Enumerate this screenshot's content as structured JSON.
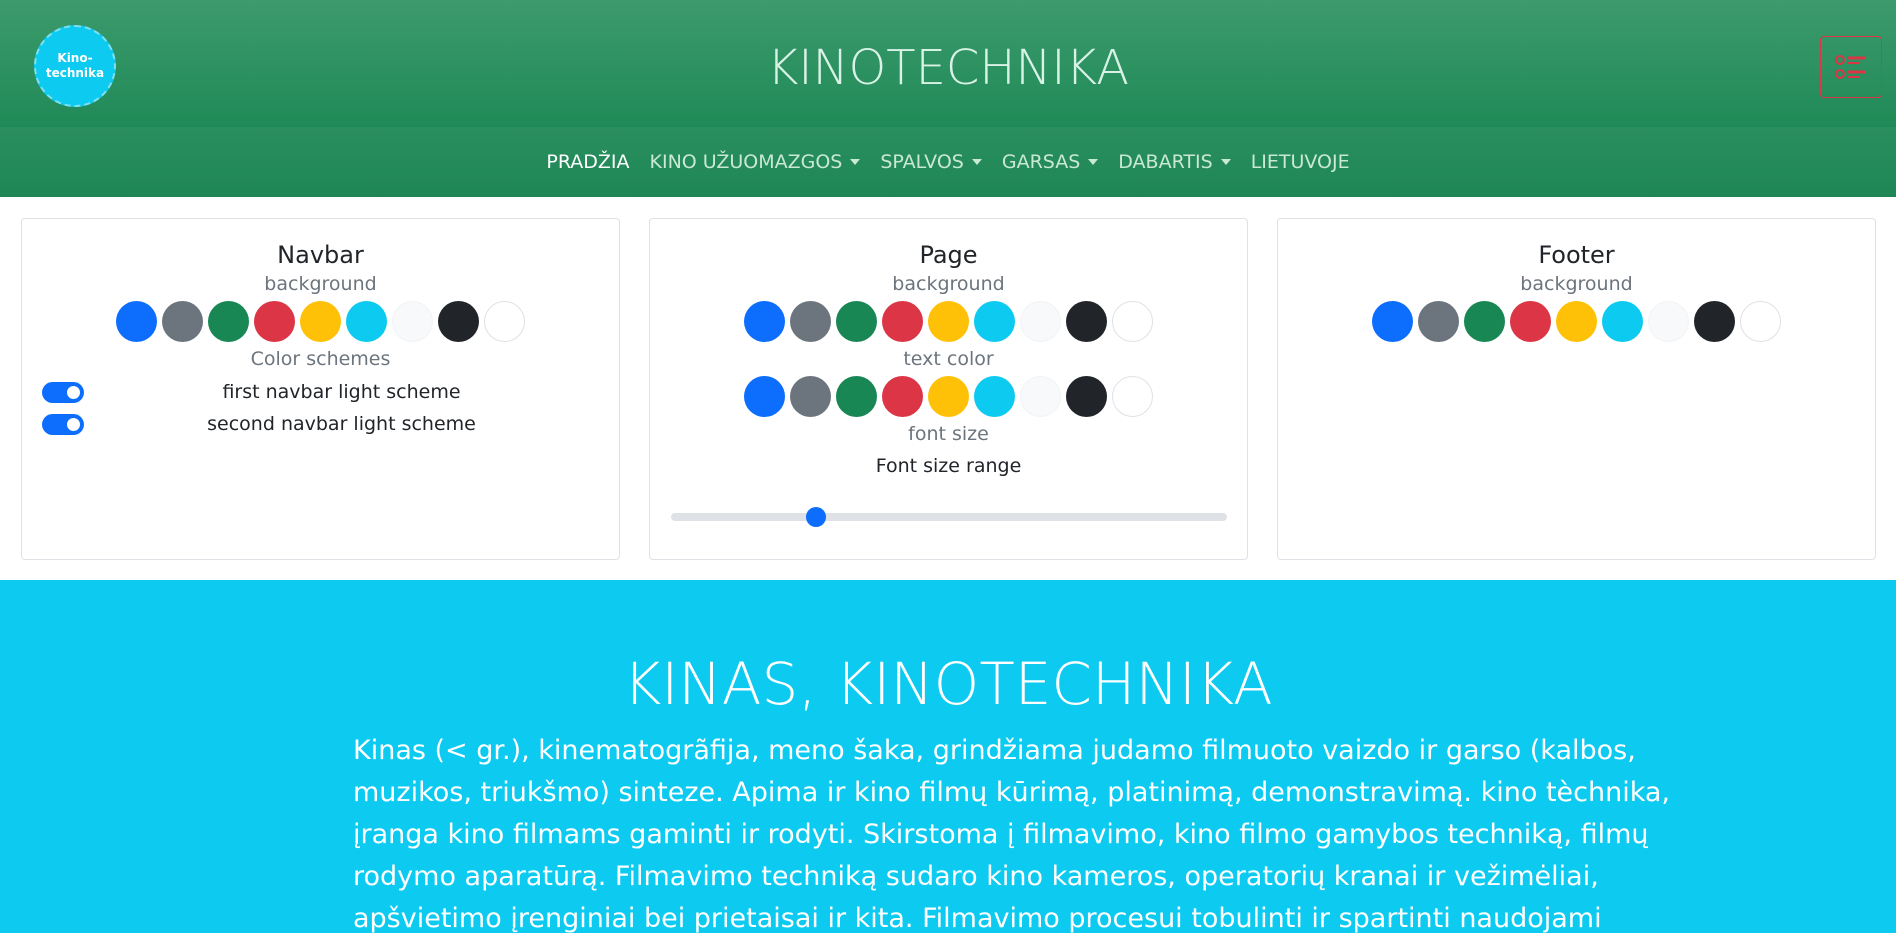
{
  "header": {
    "logo_text": "Kino-\ntechnika",
    "title": "KINOTECHNIKA",
    "settings_icon": "settings-list-icon"
  },
  "nav": {
    "items": [
      {
        "label": "PRADŽIA",
        "dropdown": false,
        "active": true
      },
      {
        "label": "KINO UŽUOMAZGOS",
        "dropdown": true,
        "active": false
      },
      {
        "label": "SPALVOS",
        "dropdown": true,
        "active": false
      },
      {
        "label": "GARSAS",
        "dropdown": true,
        "active": false
      },
      {
        "label": "DABARTIS",
        "dropdown": true,
        "active": false
      },
      {
        "label": "LIETUVOJE",
        "dropdown": false,
        "active": false
      }
    ]
  },
  "palette": [
    "#0d6efd",
    "#6c757d",
    "#198754",
    "#dc3545",
    "#ffc107",
    "#0dcaf0",
    "#f8f9fa",
    "#212529",
    "#ffffff"
  ],
  "settings": {
    "navbar": {
      "title": "Navbar",
      "background_label": "background",
      "schemes_label": "Color schemes",
      "switches": [
        {
          "label": "first navbar light scheme",
          "checked": true
        },
        {
          "label": "second navbar light scheme",
          "checked": true
        }
      ]
    },
    "page": {
      "title": "Page",
      "background_label": "background",
      "text_color_label": "text color",
      "font_size_label": "font size",
      "range_label": "Font size range",
      "range_value_fraction": 0.26
    },
    "footer": {
      "title": "Footer",
      "background_label": "background"
    }
  },
  "hero": {
    "title": "KINAS, KINOTECHNIKA",
    "lines": [
      "Kinas (< gr.), kinematogrãfija, meno šaka, grindžiama judamo filmuoto vaizdo ir garso (kalbos,",
      "muzikos, triukšmo) sinteze. Apima ir kino filmų kūrimą, platinimą, demonstravimą. kino tèchnika,",
      "įranga kino filmams gaminti ir rodyti. Skirstoma į filmavimo, kino filmo gamybos techniką, filmų",
      "rodymo aparatūrą. Filmavimo techniką sudaro kino kameros, operatorių kranai ir vežimėliai,",
      "apšvietimo įrenginiai bei prietaisai ir kita. Filmavimo procesui tobulinti ir spartinti naudojami"
    ]
  }
}
